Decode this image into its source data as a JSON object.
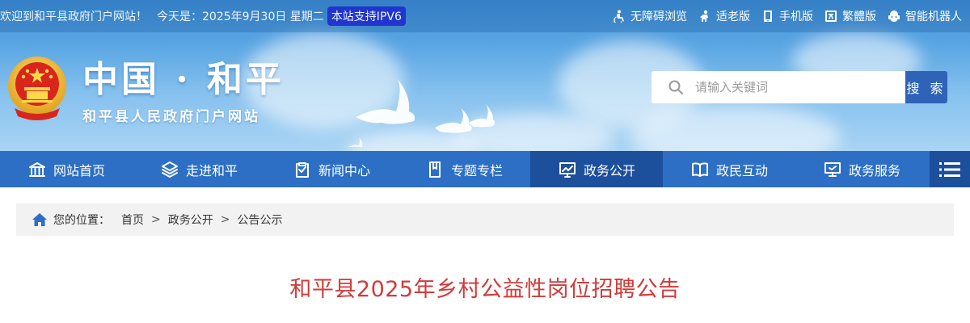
{
  "topbar": {
    "welcome": "欢迎到和平县政府门户网站！",
    "today": "今天是：2025年9月30日 星期二",
    "ipv6_badge": "本站支持IPV6",
    "links": [
      {
        "label": "无障碍浏览",
        "icon": "accessibility-icon"
      },
      {
        "label": "适老版",
        "icon": "elderly-icon"
      },
      {
        "label": "手机版",
        "icon": "mobile-icon"
      },
      {
        "label": "繁體版",
        "icon": "traditional-chinese-icon"
      },
      {
        "label": "智能机器人",
        "icon": "robot-icon"
      }
    ]
  },
  "header": {
    "title": "中国 · 和平",
    "subtitle": "和平县人民政府门户网站"
  },
  "search": {
    "placeholder": "请输入关键词",
    "button_label": "搜 索"
  },
  "nav": {
    "items": [
      {
        "label": "网站首页",
        "icon": "building-icon",
        "active": false
      },
      {
        "label": "走进和平",
        "icon": "layers-icon",
        "active": false
      },
      {
        "label": "新闻中心",
        "icon": "news-clipboard-icon",
        "active": false
      },
      {
        "label": "专题专栏",
        "icon": "bookmark-icon",
        "active": false
      },
      {
        "label": "政务公开",
        "icon": "chart-board-icon",
        "active": true
      },
      {
        "label": "政民互动",
        "icon": "open-book-icon",
        "active": false
      },
      {
        "label": "政务服务",
        "icon": "monitor-icon",
        "active": false
      }
    ],
    "more_icon": "menu-list-icon"
  },
  "breadcrumb": {
    "lead": "您的位置：",
    "items": [
      "首页",
      "政务公开",
      "公告公示"
    ],
    "separator": ">"
  },
  "article": {
    "title": "和平县2025年乡村公益性岗位招聘公告"
  },
  "colors": {
    "nav_bg": "#2d6fc4",
    "nav_active": "#1c4f9c",
    "title_red": "#d33a3a",
    "ipv6_bg": "#1f2fd0"
  }
}
